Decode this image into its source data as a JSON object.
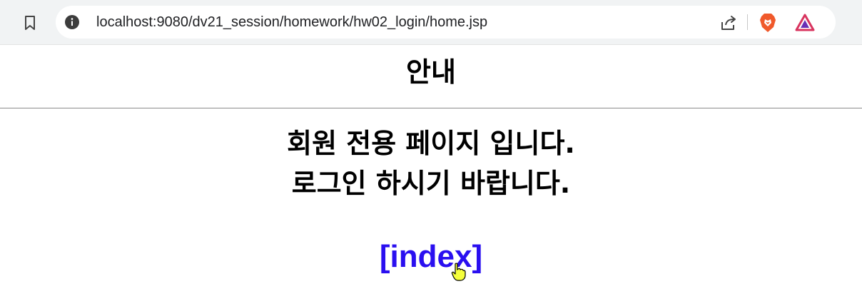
{
  "browser": {
    "url": "localhost:9080/dv21_session/homework/hw02_login/home.jsp",
    "icons": [
      "bookmark-icon",
      "info-icon",
      "share-icon",
      "brave-shield-icon",
      "brave-rewards-icon"
    ]
  },
  "page": {
    "title": "안내",
    "message_line1": "회원 전용 페이지 입니다.",
    "message_line2": "로그인 하시기 바랍니다.",
    "link_label": "[index]",
    "link_color": "#2a0ff0"
  }
}
